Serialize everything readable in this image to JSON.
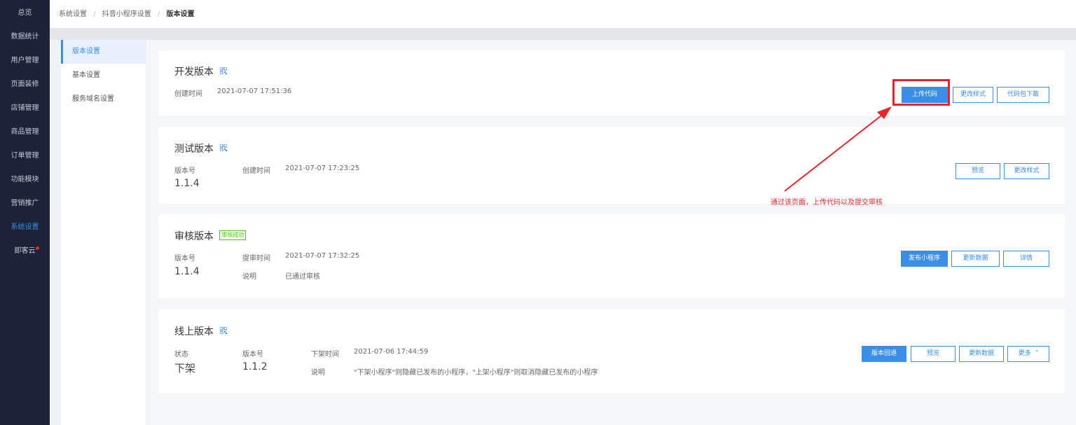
{
  "nav": {
    "items": [
      {
        "label": "总览"
      },
      {
        "label": "数据统计"
      },
      {
        "label": "用户管理"
      },
      {
        "label": "页面装修"
      },
      {
        "label": "店铺管理"
      },
      {
        "label": "商品管理"
      },
      {
        "label": "订单管理"
      },
      {
        "label": "功能模块"
      },
      {
        "label": "营销推广"
      },
      {
        "label": "系统设置",
        "active": true
      },
      {
        "label": "即客云",
        "dot": true
      }
    ]
  },
  "breadcrumb": {
    "items": [
      "系统设置",
      "抖音小程序设置"
    ],
    "current": "版本设置",
    "separator": "/"
  },
  "submenu": {
    "items": [
      {
        "label": "版本设置",
        "active": true
      },
      {
        "label": "基本设置"
      },
      {
        "label": "服务域名设置"
      }
    ]
  },
  "cards": {
    "dev": {
      "title": "开发版本",
      "create_label": "创建时间",
      "create_time": "2021-07-07 17:51:36",
      "buttons": {
        "upload": "上传代码",
        "change_style": "更改样式",
        "download": "代码包下载"
      }
    },
    "test": {
      "title": "测试版本",
      "version_label": "版本号",
      "version": "1.1.4",
      "create_label": "创建时间",
      "create_time": "2021-07-07 17:23:25",
      "buttons": {
        "preview": "预览",
        "change_style": "更改样式"
      }
    },
    "audit": {
      "title": "审核版本",
      "badge": "审核成功",
      "version_label": "版本号",
      "version": "1.1.4",
      "submit_label": "提审时间",
      "submit_time": "2021-07-07 17:32:25",
      "note_label": "说明",
      "note": "已通过审核",
      "buttons": {
        "publish": "发布小程序",
        "update": "更新数据",
        "detail": "详情"
      }
    },
    "online": {
      "title": "线上版本",
      "status_label": "状态",
      "status": "下架",
      "version_label": "版本号",
      "version": "1.1.2",
      "offline_label": "下架时间",
      "offline_time": "2021-07-06 17:44:59",
      "note_label": "说明",
      "note": "\"下架小程序\"则隐藏已发布的小程序，\"上架小程序\"则取消隐藏已发布的小程序",
      "buttons": {
        "rollback": "版本回退",
        "preview": "预览",
        "update": "更新数据",
        "more": "更多"
      }
    }
  },
  "annotation": {
    "text": "通过该页面，上传代码以及提交审核",
    "color": "#e8242a"
  },
  "colors": {
    "accent": "#3a8ee6",
    "nav_bg": "#1c2237",
    "success": "#52c41a"
  }
}
